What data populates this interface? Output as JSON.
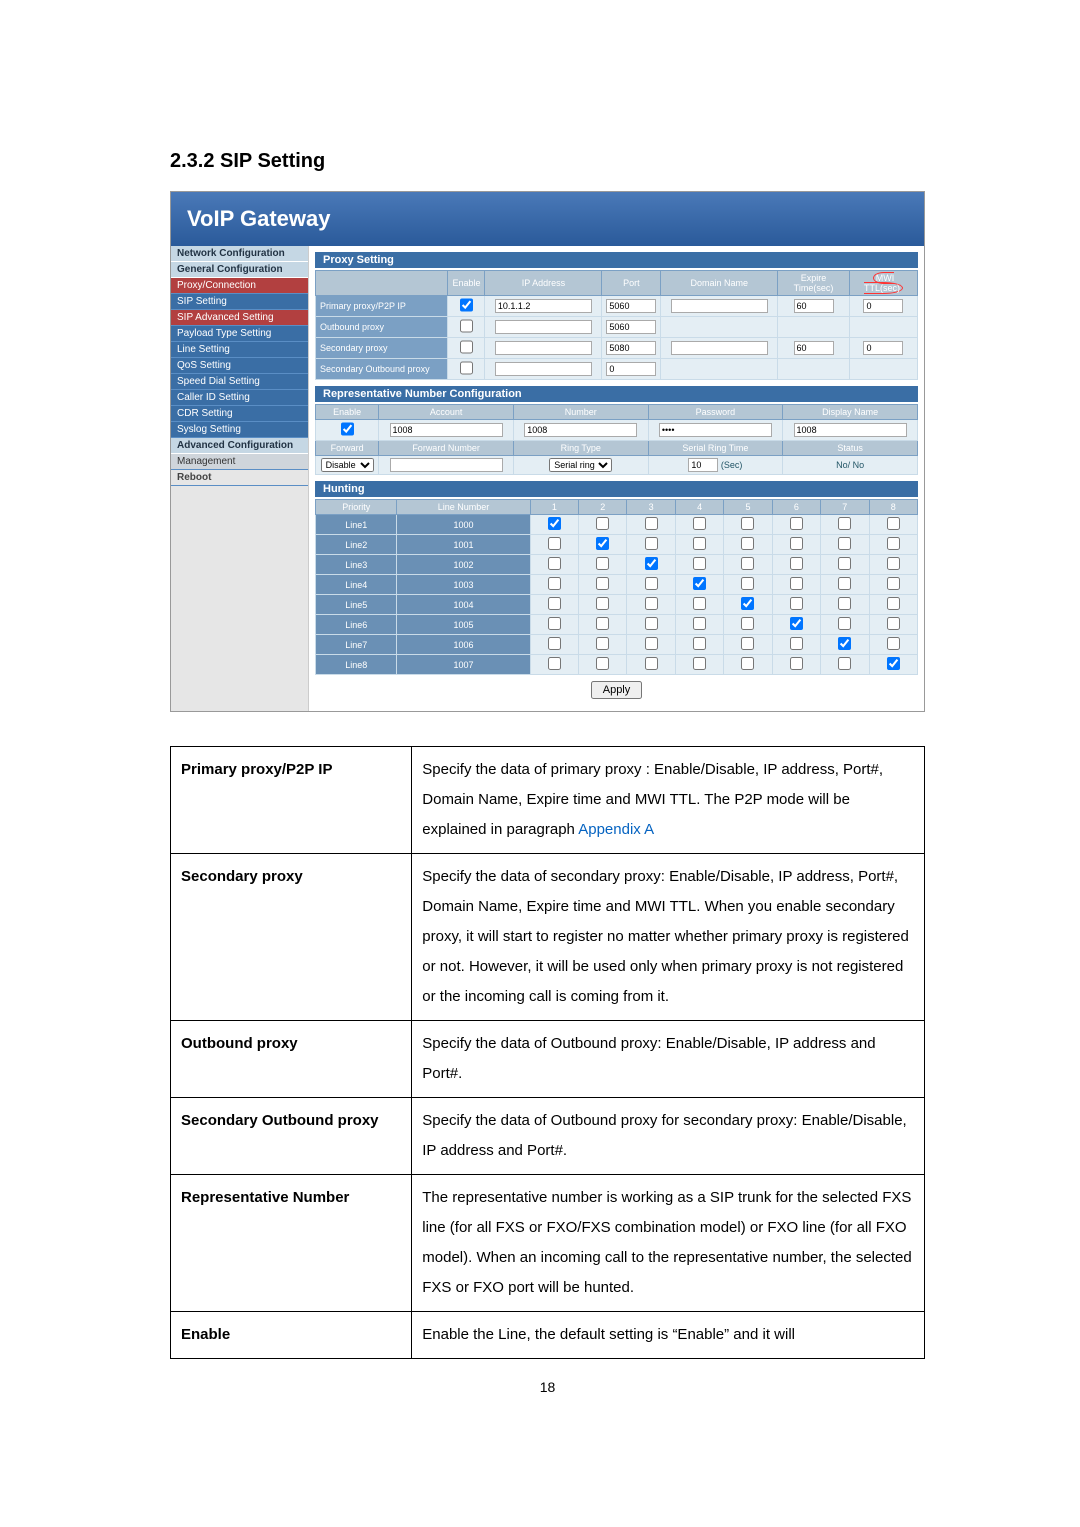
{
  "heading": "2.3.2   SIP Setting",
  "header_brand": "VoIP  Gateway",
  "nav": {
    "groups": [
      "Network Configuration",
      "General Configuration",
      "Advanced Configuration",
      "Management"
    ],
    "items_g1": [
      "Proxy/Connection",
      "SIP Setting",
      "SIP Advanced Setting",
      "Payload Type Setting",
      "Line Setting",
      "QoS Setting",
      "Speed Dial Setting",
      "Caller ID Setting",
      "CDR Setting",
      "Syslog Setting"
    ],
    "items_g3": [
      "Reboot"
    ]
  },
  "proxy_section": "Proxy Setting",
  "proxy_headers": [
    "Enable",
    "IP Address",
    "Port",
    "Domain Name",
    "Expire Time(sec)",
    "MWI TTL(sec)"
  ],
  "proxy_rows": [
    {
      "label": "Primary proxy/P2P IP",
      "enable": true,
      "ip": "10.1.1.2",
      "port": "5060",
      "domain": "",
      "expire": "60",
      "mwi": "0"
    },
    {
      "label": "Outbound proxy",
      "enable": false,
      "ip": "",
      "port": "5060",
      "domain": null,
      "expire": null,
      "mwi": null
    },
    {
      "label": "Secondary proxy",
      "enable": false,
      "ip": "",
      "port": "5080",
      "domain": "",
      "expire": "60",
      "mwi": "0"
    },
    {
      "label": "Secondary Outbound proxy",
      "enable": false,
      "ip": "",
      "port": "0",
      "domain": null,
      "expire": null,
      "mwi": null
    }
  ],
  "rep_section": "Representative Number Configuration",
  "rep_headers": [
    "Enable",
    "Account",
    "Number",
    "Password",
    "Display Name"
  ],
  "rep_row": {
    "enable": true,
    "account": "1008",
    "number": "1008",
    "password": "••••",
    "display": "1008"
  },
  "rep_headers2": [
    "Forward",
    "Forward Number",
    "Ring Type",
    "Serial Ring Time",
    "Status"
  ],
  "rep_row2": {
    "forward": "Disable",
    "fwdnum": "",
    "ringtype": "Serial ring",
    "srt": "10",
    "srt_unit": "(Sec)",
    "status": "No/ No"
  },
  "hunt_section": "Hunting",
  "hunt_headers": [
    "Priority",
    "Line Number",
    "1",
    "2",
    "3",
    "4",
    "5",
    "6",
    "7",
    "8"
  ],
  "hunt_rows": [
    {
      "line": "Line1",
      "num": "1000",
      "checks": [
        true,
        false,
        false,
        false,
        false,
        false,
        false,
        false
      ]
    },
    {
      "line": "Line2",
      "num": "1001",
      "checks": [
        false,
        true,
        false,
        false,
        false,
        false,
        false,
        false
      ]
    },
    {
      "line": "Line3",
      "num": "1002",
      "checks": [
        false,
        false,
        true,
        false,
        false,
        false,
        false,
        false
      ]
    },
    {
      "line": "Line4",
      "num": "1003",
      "checks": [
        false,
        false,
        false,
        true,
        false,
        false,
        false,
        false
      ]
    },
    {
      "line": "Line5",
      "num": "1004",
      "checks": [
        false,
        false,
        false,
        false,
        true,
        false,
        false,
        false
      ]
    },
    {
      "line": "Line6",
      "num": "1005",
      "checks": [
        false,
        false,
        false,
        false,
        false,
        true,
        false,
        false
      ]
    },
    {
      "line": "Line7",
      "num": "1006",
      "checks": [
        false,
        false,
        false,
        false,
        false,
        false,
        true,
        false
      ]
    },
    {
      "line": "Line8",
      "num": "1007",
      "checks": [
        false,
        false,
        false,
        false,
        false,
        false,
        false,
        true
      ]
    }
  ],
  "apply_label": "Apply",
  "desc": [
    {
      "k": "Primary proxy/P2P IP",
      "v": "Specify the data of primary proxy : Enable/Disable, IP address, Port#, Domain Name, Expire time and MWI TTL. The P2P mode will be explained in paragraph ",
      "link": "Appendix A"
    },
    {
      "k": "Secondary proxy",
      "v": "Specify the data of secondary proxy: Enable/Disable, IP address, Port#, Domain Name, Expire time and MWI TTL. When you enable secondary proxy, it will start to register no matter whether primary proxy is registered or not. However, it will be used only when primary proxy is not registered or the incoming call is coming from it."
    },
    {
      "k": "Outbound proxy",
      "v": "Specify the data of Outbound proxy: Enable/Disable, IP address and Port#."
    },
    {
      "k": "Secondary Outbound proxy",
      "v": "Specify the data of Outbound proxy for secondary proxy: Enable/Disable, IP address and Port#."
    },
    {
      "k": "Representative Number",
      "v": "The representative number is working as a SIP trunk for the selected FXS line (for all FXS or FXO/FXS combination model) or FXO line (for all FXO model). When an incoming call to the representative number, the selected FXS or FXO port will be hunted."
    },
    {
      "k": "Enable",
      "v": "Enable the Line, the default setting is “Enable” and it will"
    }
  ],
  "page_number": "18"
}
